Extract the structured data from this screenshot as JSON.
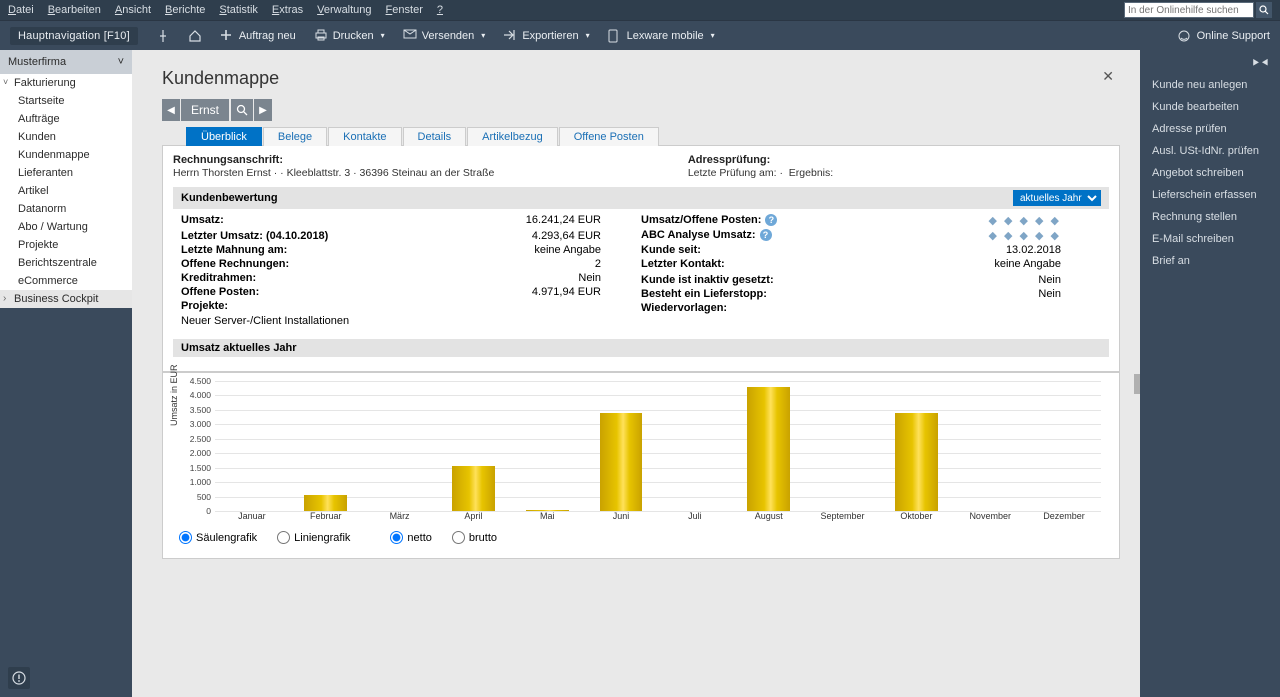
{
  "menubar": [
    "Datei",
    "Bearbeiten",
    "Ansicht",
    "Berichte",
    "Statistik",
    "Extras",
    "Verwaltung",
    "Fenster",
    "?"
  ],
  "search_help_placeholder": "In der Onlinehilfe suchen",
  "toolbar": {
    "hauptnav": "Hauptnavigation [F10]",
    "auftrag_neu": "Auftrag neu",
    "drucken": "Drucken",
    "versenden": "Versenden",
    "exportieren": "Exportieren",
    "lexware_mobile": "Lexware mobile",
    "online_support": "Online Support"
  },
  "company": "Musterfirma",
  "nav": {
    "fakturierung": "Fakturierung",
    "items": [
      "Startseite",
      "Aufträge",
      "Kunden",
      "Kundenmappe",
      "Lieferanten",
      "Artikel",
      "Datanorm",
      "Abo / Wartung",
      "Projekte",
      "Berichtszentrale",
      "eCommerce"
    ],
    "business_cockpit": "Business Cockpit"
  },
  "page_title": "Kundenmappe",
  "customer_name": "Ernst",
  "tabs": [
    "Überblick",
    "Belege",
    "Kontakte",
    "Details",
    "Artikelbezug",
    "Offene Posten"
  ],
  "addr": {
    "h_left": "Rechnungsanschrift:",
    "line": "Herrn Thorsten Ernst ·  · Kleeblattstr. 3 · 36396 Steinau an der Straße",
    "h_right": "Adressprüfung:",
    "last_check": "Letzte Prüfung am:",
    "last_check_v": "·",
    "result": "Ergebnis:"
  },
  "section_kundenbewertung": "Kundenbewertung",
  "year_select": "aktuelles Jahr",
  "kv_left": [
    {
      "lbl": "Umsatz:",
      "val": "16.241,24 EUR"
    },
    {
      "lbl": "",
      "val": ""
    },
    {
      "lbl": "Letzter Umsatz: (04.10.2018)",
      "val": "4.293,64 EUR"
    },
    {
      "lbl": "Letzte Mahnung am:",
      "val": "keine Angabe"
    },
    {
      "lbl": "Offene Rechnungen:",
      "val": "2"
    },
    {
      "lbl": "Kreditrahmen:",
      "val": "Nein"
    },
    {
      "lbl": "Offene Posten:",
      "val": "4.971,94 EUR"
    },
    {
      "lbl": "Projekte:",
      "val": ""
    }
  ],
  "kv_right": [
    {
      "lbl": "Umsatz/Offene Posten:",
      "val": "stars",
      "info": true
    },
    {
      "lbl": "ABC Analyse Umsatz:",
      "val": "stars",
      "info": true
    },
    {
      "lbl": "Kunde seit:",
      "val": "13.02.2018"
    },
    {
      "lbl": "Letzter Kontakt:",
      "val": "keine Angabe"
    },
    {
      "lbl": "",
      "val": ""
    },
    {
      "lbl": "Kunde ist inaktiv gesetzt:",
      "val": "Nein"
    },
    {
      "lbl": "Besteht ein Lieferstopp:",
      "val": "Nein"
    },
    {
      "lbl": "Wiedervorlagen:",
      "val": ""
    }
  ],
  "projekte_text": "Neuer Server-/Client Installationen",
  "section_umsatz": "Umsatz aktuelles Jahr",
  "chart_data": {
    "type": "bar",
    "categories": [
      "Januar",
      "Februar",
      "März",
      "April",
      "Mai",
      "Juni",
      "Juli",
      "August",
      "September",
      "Oktober",
      "November",
      "Dezember"
    ],
    "values": [
      0,
      550,
      0,
      1550,
      20,
      3400,
      0,
      4300,
      0,
      3400,
      0,
      0
    ],
    "ylabel": "Umsatz in EUR",
    "ylim": [
      0,
      4500
    ],
    "yticks": [
      0,
      500,
      1000,
      1500,
      2000,
      2500,
      3000,
      3500,
      4000,
      4500
    ]
  },
  "chart_opts": {
    "type": {
      "bar": "Säulengrafik",
      "line": "Liniengrafik",
      "selected": "bar"
    },
    "amount": {
      "netto": "netto",
      "brutto": "brutto",
      "selected": "netto"
    }
  },
  "right_actions": [
    "Kunde neu anlegen",
    "Kunde bearbeiten",
    "Adresse prüfen",
    "Ausl. USt-IdNr. prüfen",
    "Angebot schreiben",
    "Lieferschein erfassen",
    "Rechnung stellen",
    "E-Mail schreiben",
    "Brief an"
  ]
}
